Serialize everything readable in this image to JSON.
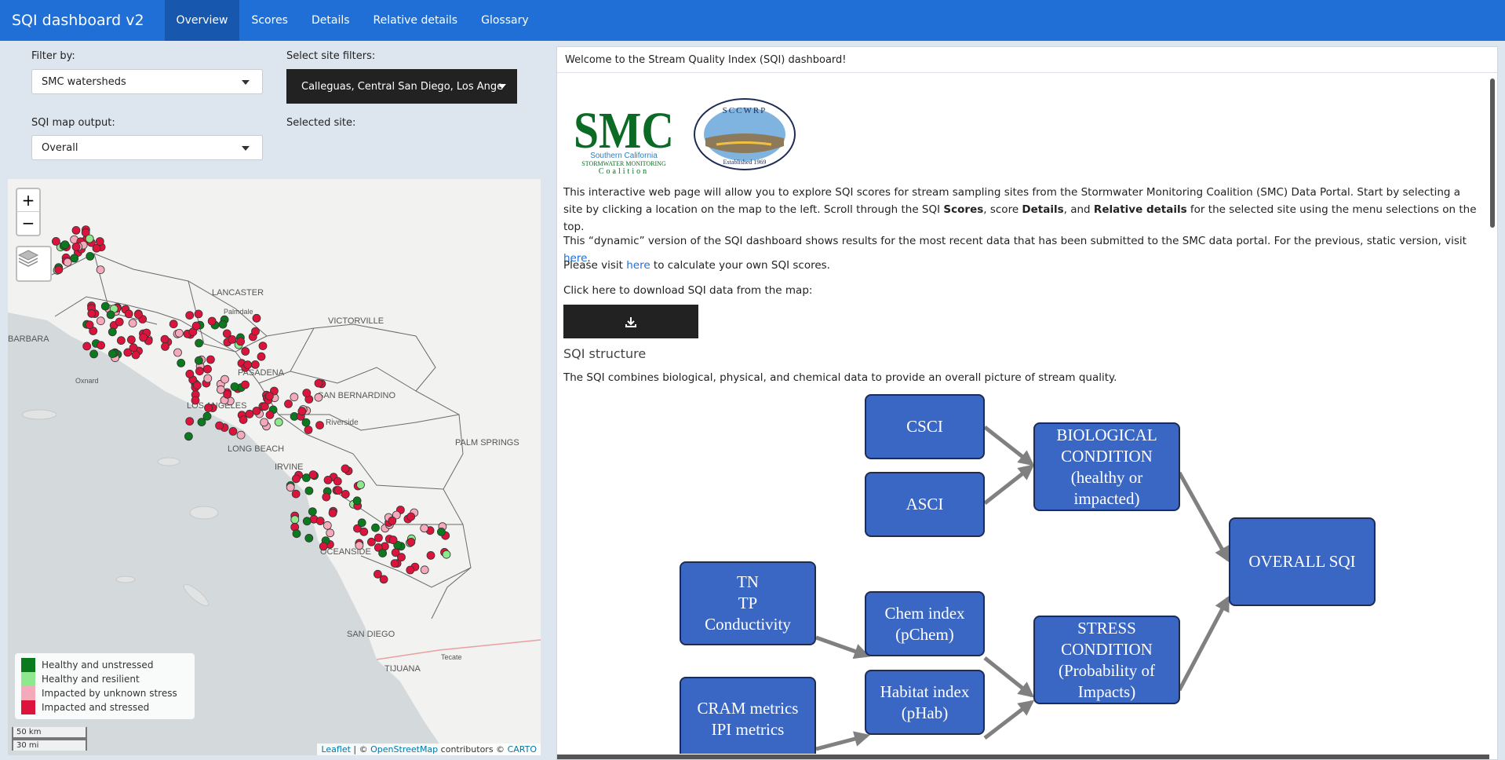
{
  "navbar": {
    "brand": "SQI dashboard v2",
    "tabs": [
      {
        "label": "Overview"
      },
      {
        "label": "Scores"
      },
      {
        "label": "Details"
      },
      {
        "label": "Relative details"
      },
      {
        "label": "Glossary"
      }
    ],
    "active_tab": "Overview",
    "color": "#1f6fd6"
  },
  "sidebar": {
    "filter_label": "Filter by:",
    "filter_value": "SMC watersheds",
    "site_filters_label": "Select site filters:",
    "site_filters_value": "Calleguas, Central San Diego, Los Ange",
    "map_output_label": "SQI map output:",
    "map_output_value": "Overall",
    "selected_site_label": "Selected site:"
  },
  "map": {
    "zoom_in": "+",
    "zoom_out": "−",
    "place_labels": [
      "LANCASTER",
      "Palmdale",
      "VICTORVILLE",
      "BARBARA",
      "Oxnard",
      "PASADENA",
      "LOS ANGELES",
      "SAN BERNARDINO",
      "Riverside",
      "LONG BEACH",
      "IRVINE",
      "PALM SPRINGS",
      "OCEANSIDE",
      "SAN DIEGO",
      "TIJUANA",
      "Tecate"
    ],
    "legend": [
      {
        "label": "Healthy and unstressed",
        "color": "#0b7a1f"
      },
      {
        "label": "Healthy and resilient",
        "color": "#8ee88e"
      },
      {
        "label": "Impacted by unknown stress",
        "color": "#f4aabb"
      },
      {
        "label": "Impacted and stressed",
        "color": "#dc143c"
      }
    ],
    "scale_km": "50 km",
    "scale_mi": "30 mi",
    "attribution_leaflet": "Leaflet",
    "attribution_sep1": " | © ",
    "attribution_osm": "OpenStreetMap",
    "attribution_sep2": " contributors © ",
    "attribution_carto": "CARTO"
  },
  "main": {
    "welcome": "Welcome to the Stream Quality Index (SQI) dashboard!",
    "logos": {
      "smc_letters": "SMC",
      "smc_line1": "Southern California",
      "smc_line2": "STORMWATER MONITORING",
      "smc_line3": "Coalition",
      "sccwrp_name": "SCCWRP",
      "sccwrp_est": "Established 1969"
    },
    "intro_1": "This interactive web page will allow you to explore SQI scores for stream sampling sites from the Stormwater Monitoring Coalition (SMC) Data Portal. Start by selecting a site by clicking a location on the map to the left. Scroll through the SQI ",
    "intro_scores": "Scores",
    "intro_2": ", score ",
    "intro_details": "Details",
    "intro_3": ", and ",
    "intro_relative": "Relative details",
    "intro_4": " for the selected site using the menu selections on the top.",
    "dynamic_1": "This “dynamic” version of the SQI dashboard shows results for the most recent data that has been submitted to the SMC data portal. For the previous, static version, visit ",
    "dynamic_link": "here",
    "dynamic_2": ".",
    "visit_1": "Please visit ",
    "visit_link": "here",
    "visit_2": " to calculate your own SQI scores.",
    "download_label": "Click here to download SQI data from the map:",
    "structure_heading": "SQI structure",
    "structure_text": "The SQI combines biological, physical, and chemical data to provide an overall picture of stream quality.",
    "diagram": {
      "csci": "CSCI",
      "asci": "ASCI",
      "biological": "BIOLOGICAL\nCONDITION\n(healthy or\nimpacted)",
      "overall": "OVERALL SQI",
      "tn_tp": "TN\nTP\nConductivity",
      "chem": "Chem index\n(pChem)",
      "cram": "CRAM metrics\nIPI metrics",
      "habitat": "Habitat index\n(pHab)",
      "stress": "STRESS\nCONDITION\n(Probability of\nImpacts)"
    }
  }
}
